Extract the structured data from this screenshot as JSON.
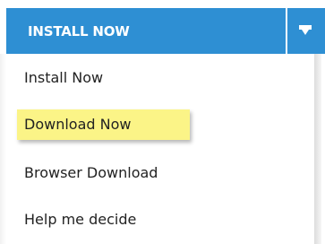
{
  "split_button": {
    "label": "INSTALL NOW",
    "toggle_icon": "caret-down-icon",
    "color": "#2e8fd3"
  },
  "menu": {
    "items": [
      {
        "label": "Install Now",
        "highlighted": false
      },
      {
        "label": "Download Now",
        "highlighted": true
      },
      {
        "label": "Browser Download",
        "highlighted": false
      },
      {
        "label": "Help me decide",
        "highlighted": false
      }
    ],
    "highlight_color": "#fbf487"
  }
}
